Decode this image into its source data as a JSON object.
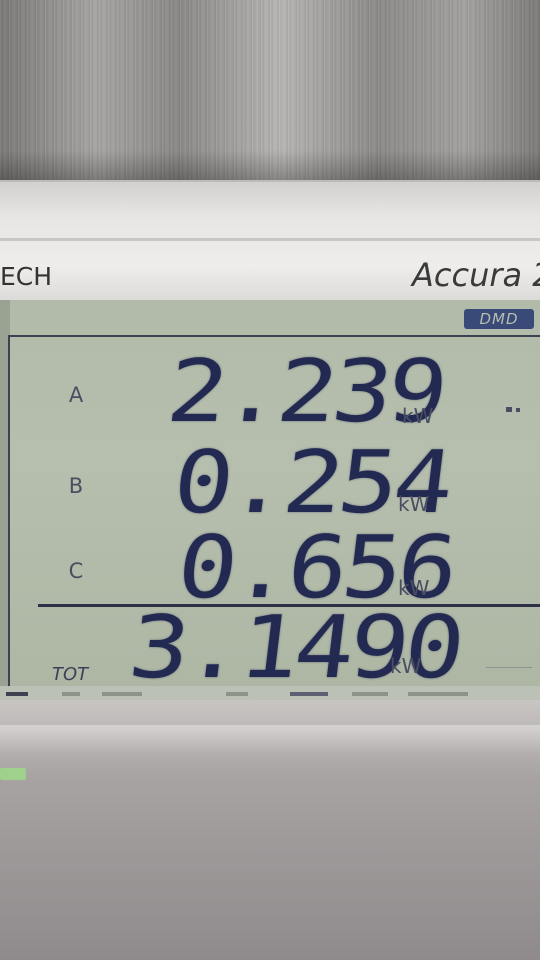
{
  "device": {
    "brand_left": "ECH",
    "model": "Accura 2",
    "badge": "DMD"
  },
  "readings": [
    {
      "phase": "A",
      "value": "2.239",
      "unit": "kW"
    },
    {
      "phase": "B",
      "value": "0.254",
      "unit": "kW"
    },
    {
      "phase": "C",
      "value": "0.656",
      "unit": "kW"
    }
  ],
  "total": {
    "label": "TOT",
    "value": "3.1490",
    "unit": "kW"
  },
  "colors": {
    "lcd_background": "#b2baa9",
    "segment": "#232a52",
    "badge": "#394a78"
  }
}
